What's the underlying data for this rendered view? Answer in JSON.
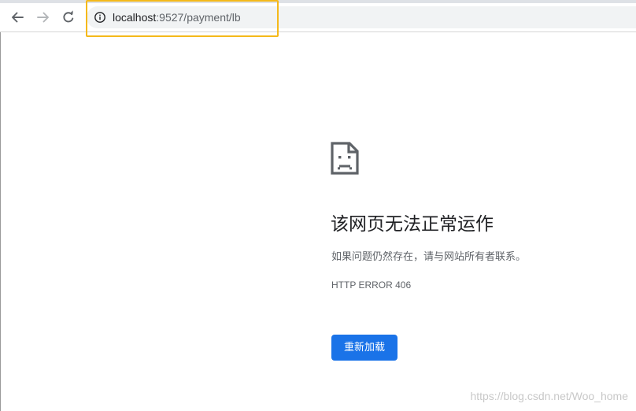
{
  "browser": {
    "url_host": "localhost",
    "url_path": ":9527/payment/lb",
    "icons": {
      "back": "back-arrow-icon",
      "forward": "forward-arrow-icon",
      "reload": "reload-icon",
      "site_info": "info-icon"
    },
    "highlight_color": "#f5b91a"
  },
  "error_page": {
    "icon": "sad-page-icon",
    "title": "该网页无法正常运作",
    "description": "如果问题仍然存在，请与网站所有者联系。",
    "error_code": "HTTP ERROR 406",
    "reload_label": "重新加载",
    "button_color": "#1a73e8"
  },
  "watermark": "https://blog.csdn.net/Woo_home"
}
